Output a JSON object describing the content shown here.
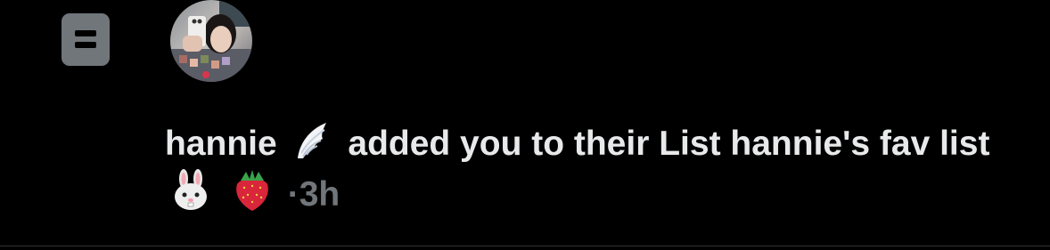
{
  "notification": {
    "icon": "list-icon",
    "avatar": "avatar",
    "user_name": "hannie",
    "name_emoji": "wing-emoji",
    "action_text": "added you to their List",
    "list_name": "hannie's fav list",
    "list_emojis": [
      "rabbit-face-emoji",
      "strawberry-emoji"
    ],
    "separator": "·",
    "timestamp": "3h"
  },
  "colors": {
    "background": "#000000",
    "text": "#e7e9ea",
    "secondary_text": "#71767b",
    "divider": "#2f3336"
  }
}
